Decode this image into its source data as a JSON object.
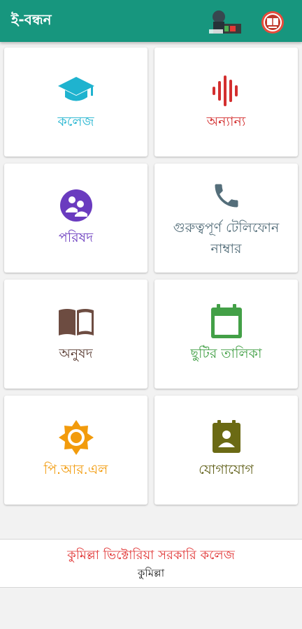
{
  "appbar": {
    "title": "ই-বন্ধন",
    "background": "#17967e"
  },
  "cards": [
    {
      "label": "কলেজ",
      "icon": "graduation-cap-icon",
      "color": "#1fb3cf"
    },
    {
      "label": "অন্যান্য",
      "icon": "voice-waveform-icon",
      "color": "#d32f2f"
    },
    {
      "label": "পরিষদ",
      "icon": "group-icon",
      "color": "#6a3bbf"
    },
    {
      "label_line1": "গুরুত্বপূর্ণ টেলিফোন",
      "label_line2": "নাম্বার",
      "icon": "phone-icon",
      "color": "#546e7a"
    },
    {
      "label": "অনুষদ",
      "icon": "book-icon",
      "color": "#6d4c41"
    },
    {
      "label": "ছুটির তালিকা",
      "icon": "calendar-icon",
      "color": "#43a047"
    },
    {
      "label": "পি.আর.এল",
      "icon": "sun-icon",
      "color": "#f29b0c"
    },
    {
      "label": "যোগাযোগ",
      "icon": "contact-icon",
      "color": "#6b6a14"
    }
  ],
  "footer": {
    "college": "কুমিল্লা ভিক্টোরিয়া সরকারি কলেজ",
    "district": "কুমিল্লা"
  }
}
